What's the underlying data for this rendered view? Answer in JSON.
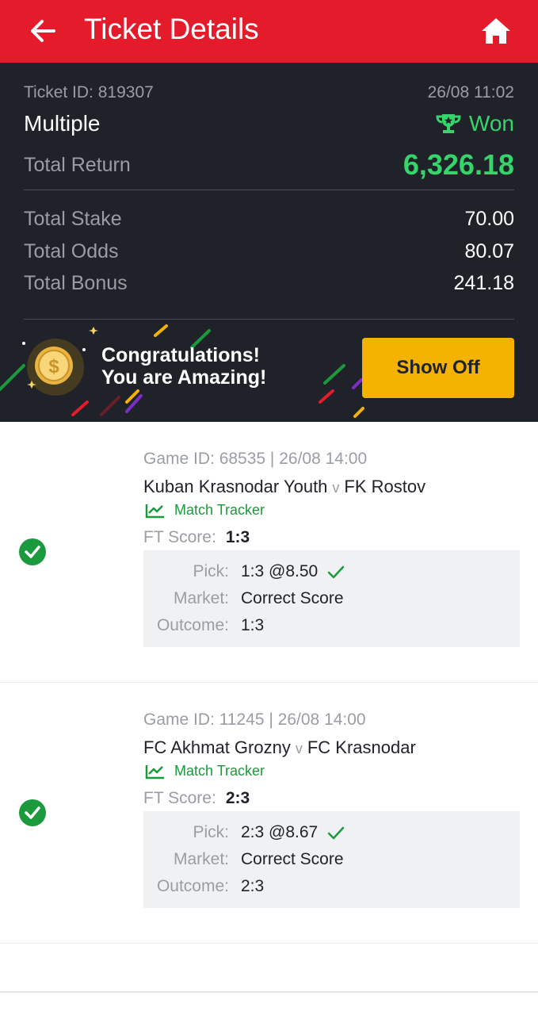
{
  "header": {
    "title": "Ticket Details"
  },
  "ticket": {
    "id_text": "Ticket ID: 819307",
    "datetime": "26/08 11:02",
    "type": "Multiple",
    "status": "Won",
    "total_return_label": "Total Return",
    "total_return": "6,326.18",
    "rows": [
      {
        "label": "Total Stake",
        "value": "70.00"
      },
      {
        "label": "Total Odds",
        "value": "80.07"
      },
      {
        "label": "Total Bonus",
        "value": "241.18"
      }
    ]
  },
  "promo": {
    "line1": "Congratulations!",
    "line2": "You are Amazing!",
    "button": "Show Off"
  },
  "games": [
    {
      "meta": "Game ID: 68535 | 26/08 14:00",
      "home": "Kuban Krasnodar Youth",
      "vs": "v",
      "away": "FK Rostov",
      "tracker": "Match Tracker",
      "score_label": "FT Score:",
      "score": "1:3",
      "pick_label": "Pick:",
      "pick": "1:3 @8.50",
      "market_label": "Market:",
      "market": "Correct Score",
      "outcome_label": "Outcome:",
      "outcome": "1:3"
    },
    {
      "meta": "Game ID: 11245 | 26/08 14:00",
      "home": "FC Akhmat Grozny",
      "vs": "v",
      "away": "FC Krasnodar",
      "tracker": "Match Tracker",
      "score_label": "FT Score:",
      "score": "2:3",
      "pick_label": "Pick:",
      "pick": "2:3 @8.67",
      "market_label": "Market:",
      "market": "Correct Score",
      "outcome_label": "Outcome:",
      "outcome": "2:3"
    }
  ],
  "icons": {
    "back": "arrow-left-icon",
    "home": "home-icon",
    "won": "trophy-icon",
    "coin": "dollar-coin-icon",
    "tracker": "chart-line-icon",
    "check": "check-icon"
  },
  "colors": {
    "header": "#e41b2b",
    "summary_bg": "#1f2228",
    "won": "#36d46b",
    "accent_button": "#f5b301",
    "success": "#1a9a3c"
  }
}
